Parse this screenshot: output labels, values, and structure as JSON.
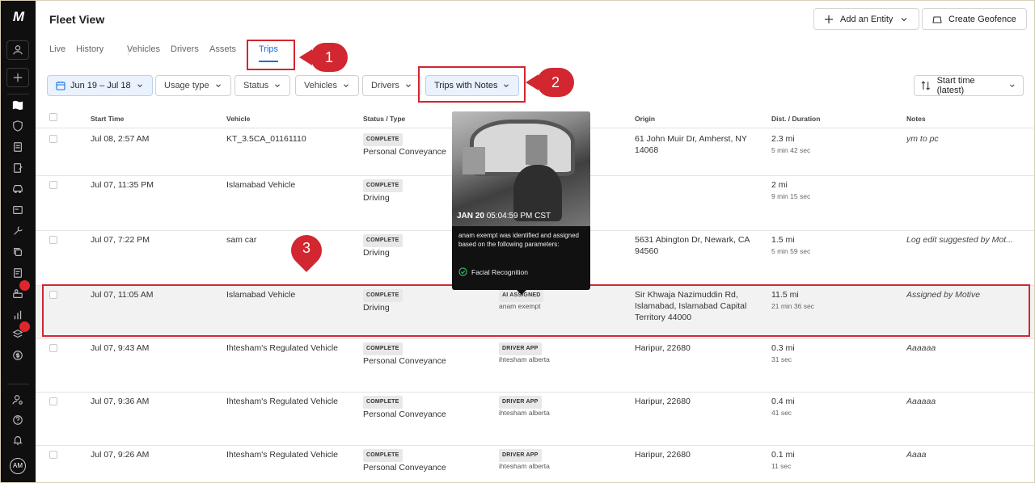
{
  "rail": {
    "logo": "M",
    "avatar": "AM"
  },
  "header": {
    "title": "Fleet View",
    "add_entity": "Add an Entity",
    "create_geofence": "Create Geofence"
  },
  "tabs": [
    "Live",
    "History",
    "Vehicles",
    "Drivers",
    "Assets",
    "Trips"
  ],
  "filters": {
    "date_range": "Jun 19 – Jul 18",
    "usage_type": "Usage type",
    "status": "Status",
    "vehicles": "Vehicles",
    "drivers": "Drivers",
    "trips_with_notes": "Trips with Notes",
    "sort": "Start time (latest)"
  },
  "callouts": [
    "1",
    "2",
    "3"
  ],
  "columns": {
    "start_time": "Start Time",
    "vehicle": "Vehicle",
    "status_type": "Status / Type",
    "origin": "Origin",
    "dist_duration": "Dist. / Duration",
    "notes": "Notes"
  },
  "rows": [
    {
      "start": "Jul 08, 2:57 AM",
      "vehicle": "KT_3.5CA_01161110",
      "status": "COMPLETE",
      "type": "Personal Conveyance",
      "assign_badge": "",
      "driver": "",
      "origin": [
        "61 John Muir Dr, Amherst, NY",
        "14068"
      ],
      "dist": "2.3 mi",
      "duration": "5 min 42 sec",
      "notes": "ym to pc"
    },
    {
      "start": "Jul 07, 11:35 PM",
      "vehicle": "Islamabad Vehicle",
      "status": "COMPLETE",
      "type": "Driving",
      "assign_badge": "",
      "driver": "",
      "origin": [
        "",
        ""
      ],
      "dist": "2 mi",
      "duration": "9 min 15 sec",
      "notes": ""
    },
    {
      "start": "Jul 07, 7:22 PM",
      "vehicle": "sam car",
      "status": "COMPLETE",
      "type": "Driving",
      "assign_badge": "",
      "driver": "",
      "origin": [
        "5631 Abington Dr, Newark, CA",
        "94560"
      ],
      "dist": "1.5 mi",
      "duration": "5 min 59 sec",
      "notes": "Log edit suggested by Mot..."
    },
    {
      "start": "Jul 07, 11:05 AM",
      "vehicle": "Islamabad Vehicle",
      "status": "COMPLETE",
      "type": "Driving",
      "assign_badge": "AI ASSIGNED",
      "driver": "anam exempt",
      "origin": [
        "Sir Khwaja Nazimuddin Rd,",
        "Islamabad, Islamabad Capital",
        "Territory 44000"
      ],
      "dist": "11.5 mi",
      "duration": "21 min 36 sec",
      "notes": "Assigned by Motive"
    },
    {
      "start": "Jul 07, 9:43 AM",
      "vehicle": "Ihtesham's Regulated Vehicle",
      "status": "COMPLETE",
      "type": "Personal Conveyance",
      "assign_badge": "DRIVER APP",
      "driver": "ihtesham alberta",
      "origin": [
        "Haripur, 22680",
        ""
      ],
      "dist": "0.3 mi",
      "duration": "31 sec",
      "notes": "Aaaaaa"
    },
    {
      "start": "Jul 07, 9:36 AM",
      "vehicle": "Ihtesham's Regulated Vehicle",
      "status": "COMPLETE",
      "type": "Personal Conveyance",
      "assign_badge": "DRIVER APP",
      "driver": "ihtesham alberta",
      "origin": [
        "Haripur, 22680",
        ""
      ],
      "dist": "0.4 mi",
      "duration": "41 sec",
      "notes": "Aaaaaa"
    },
    {
      "start": "Jul 07, 9:26 AM",
      "vehicle": "Ihtesham's Regulated Vehicle",
      "status": "COMPLETE",
      "type": "Personal Conveyance",
      "assign_badge": "DRIVER APP",
      "driver": "ihtesham alberta",
      "origin": [
        "Haripur, 22680",
        ""
      ],
      "dist": "0.1 mi",
      "duration": "11 sec",
      "notes": "Aaaa"
    }
  ],
  "tooltip": {
    "date": "JAN 20",
    "time": "05:04:59 PM CST",
    "message": "anam exempt was identified and assigned based on the following parameters:",
    "parameter": "Facial Recognition"
  },
  "colors": {
    "accent": "#1b6ee0",
    "callout": "#d22630",
    "rail": "#0f0f0f"
  }
}
